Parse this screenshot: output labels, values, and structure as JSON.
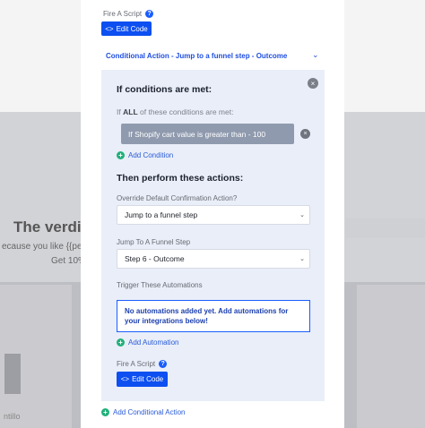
{
  "background": {
    "heading": "The verdi",
    "line1": "ecause you like {{perso",
    "line2": "Get 10%",
    "line3": "ntillo"
  },
  "panel": {
    "fire_script_label": "Fire A Script",
    "edit_code_label": "Edit Code",
    "conditional_title": "Conditional Action - Jump to a funnel step - Outcome",
    "if_conditions_heading": "If conditions are met:",
    "if_all_prefix": "If",
    "if_all_bold": "ALL",
    "if_all_suffix": "of these conditions are met:",
    "condition_pill": "If Shopify cart value is greater than - 100",
    "add_condition_label": "Add Condition",
    "then_heading": "Then perform these actions:",
    "override_label": "Override Default Confirmation Action?",
    "override_value": "Jump to a funnel step",
    "jump_label": "Jump To A Funnel Step",
    "jump_value": "Step 6 - Outcome",
    "trigger_label": "Trigger These Automations",
    "no_automations_text": "No automations added yet. Add automations for your integrations below!",
    "add_automation_label": "Add Automation",
    "fire_script_label_2": "Fire A Script",
    "edit_code_label_2": "Edit Code",
    "add_conditional_action_label": "Add Conditional Action"
  },
  "icons": {
    "help": "?",
    "code": "<>",
    "close": "×",
    "plus": "+",
    "chevron": "⌄",
    "caret": "⌄"
  },
  "colors": {
    "accent_blue": "#0d4ff0",
    "add_green": "#20b07a",
    "pill_gray": "#8f9aae",
    "inner_bg": "#e9eef8"
  }
}
